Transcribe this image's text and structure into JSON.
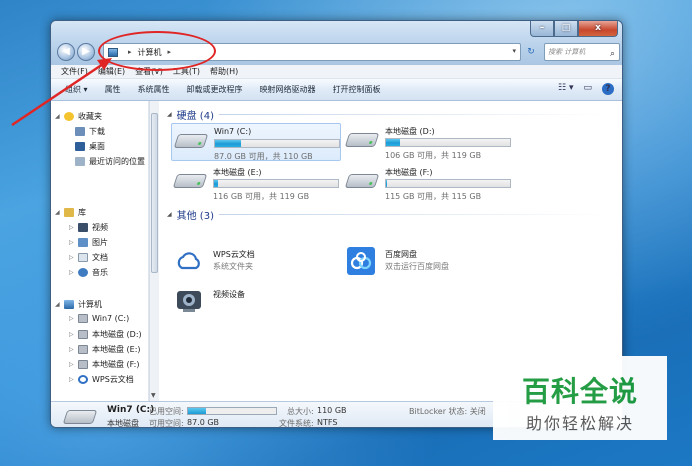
{
  "window": {
    "caption": {
      "minimize": "–",
      "maximize": "□",
      "close": "x"
    },
    "nav": {
      "back": "◀",
      "forward": "▶"
    },
    "address": {
      "sep1": "▸",
      "location": "计算机",
      "sep2": "▸",
      "dropdown": "▾"
    },
    "refresh": "↻",
    "search": {
      "placeholder": "搜索 计算机",
      "icon": "⌕"
    }
  },
  "menubar": [
    "文件(F)",
    "编辑(E)",
    "查看(V)",
    "工具(T)",
    "帮助(H)"
  ],
  "toolbar": {
    "items": [
      "组织 ▾",
      "属性",
      "系统属性",
      "卸载或更改程序",
      "映射网络驱动器",
      "打开控制面板"
    ],
    "view_icon": "☷ ▾",
    "pane_icon": "▭",
    "help_icon": "?"
  },
  "nav_pane": {
    "favorites": {
      "label": "收藏夹",
      "items": [
        "下载",
        "桌面",
        "最近访问的位置"
      ]
    },
    "libraries": {
      "label": "库",
      "items": [
        "视频",
        "图片",
        "文档",
        "音乐"
      ]
    },
    "computer": {
      "label": "计算机",
      "items": [
        "Win7 (C:)",
        "本地磁盘 (D:)",
        "本地磁盘 (E:)",
        "本地磁盘 (F:)",
        "WPS云文档"
      ]
    }
  },
  "content": {
    "hard_disks": {
      "header": "硬盘 (4)",
      "drives": [
        {
          "name": "Win7 (C:)",
          "info": "87.0 GB 可用，共 110 GB",
          "used_fraction": 0.21
        },
        {
          "name": "本地磁盘 (D:)",
          "info": "106 GB 可用，共 119 GB",
          "used_fraction": 0.11
        },
        {
          "name": "本地磁盘 (E:)",
          "info": "116 GB 可用，共 119 GB",
          "used_fraction": 0.03
        },
        {
          "name": "本地磁盘 (F:)",
          "info": "115 GB 可用，共 115 GB",
          "used_fraction": 0.01
        }
      ]
    },
    "other": {
      "header": "其他 (3)",
      "items": [
        {
          "name": "WPS云文档",
          "sub": "系统文件夹"
        },
        {
          "name": "百度网盘",
          "sub": "双击运行百度网盘"
        },
        {
          "name": "视频设备",
          "sub": ""
        }
      ]
    }
  },
  "details": {
    "name": "Win7 (C:)",
    "type": "本地磁盘",
    "used_label": "已用空间:",
    "free_label": "可用空间:",
    "free_value": "87.0 GB",
    "total_label": "总大小:",
    "total_value": "110 GB",
    "fs_label": "文件系统:",
    "fs_value": "NTFS",
    "bitlocker": "BitLocker 状态: 关闭",
    "used_fraction": 0.21
  },
  "watermark": {
    "main": "百科全说",
    "sub": "助你轻松解决"
  },
  "colors": {
    "accent": "#1d9bd6",
    "annotation": "#e02525",
    "watermark_green": "#1d9a3e"
  }
}
